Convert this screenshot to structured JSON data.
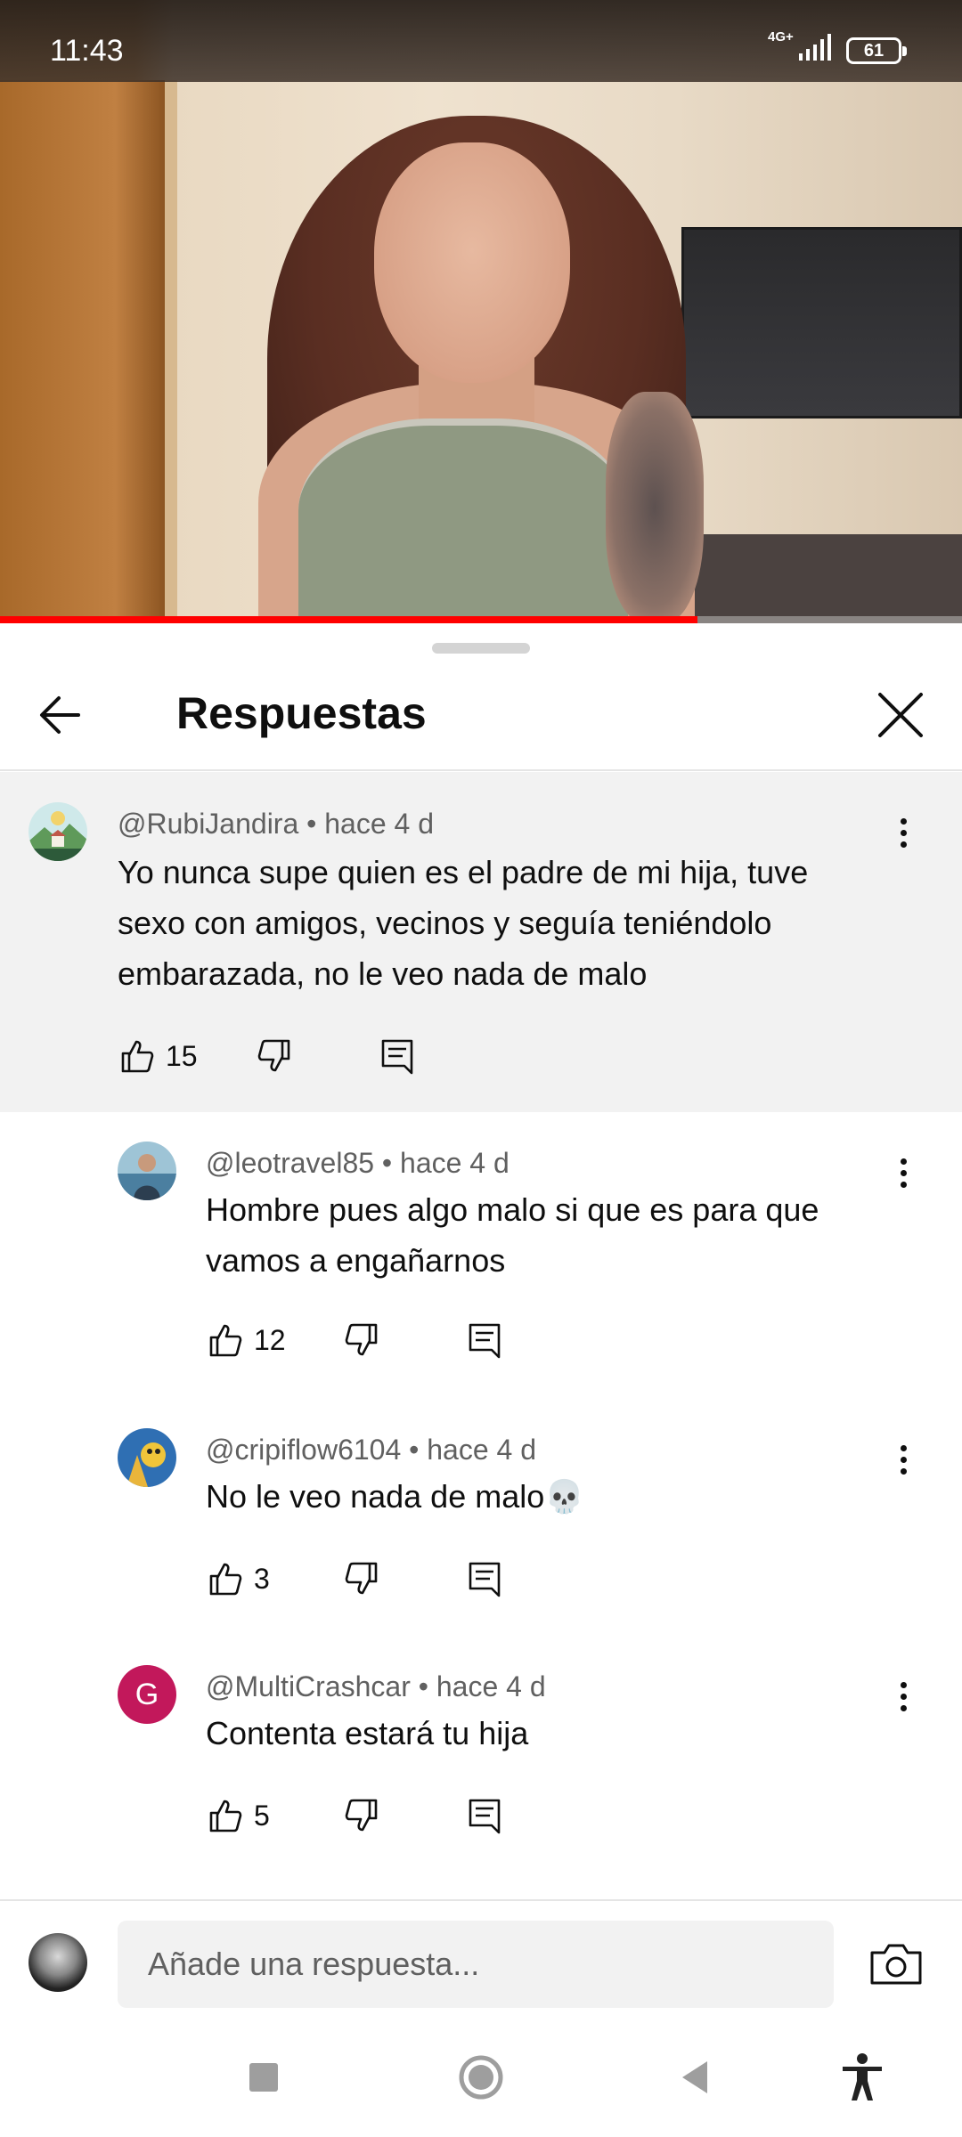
{
  "status_bar": {
    "time": "11:43",
    "network": "4G+",
    "battery": "61"
  },
  "video": {
    "progress_fraction": 0.725
  },
  "header": {
    "title": "Respuestas"
  },
  "parent_comment": {
    "author": "@RubiJandira",
    "age": "hace 4 d",
    "text": "Yo nunca supe quien es el padre de mi hija, tuve sexo con amigos, vecinos y seguía teniéndolo embarazada, no le veo nada de malo",
    "likes": "15"
  },
  "replies": [
    {
      "author": "@leotravel85",
      "age": "hace 4 d",
      "text": "Hombre pues algo malo si que es para que vamos a engañarnos",
      "likes": "12"
    },
    {
      "author": "@cripiflow6104",
      "age": "hace 4 d",
      "text": "No le veo nada de malo💀",
      "likes": "3"
    },
    {
      "author": "@MultiCrashcar",
      "age": "hace 4 d",
      "text": "Contenta estará tu hija",
      "likes": "5",
      "avatar_letter": "G",
      "avatar_color": "#c2185b"
    }
  ],
  "composer": {
    "placeholder": "Añade una respuesta..."
  },
  "colors": {
    "progress": "#ff0000",
    "parent_bg": "#f2f2f2"
  }
}
